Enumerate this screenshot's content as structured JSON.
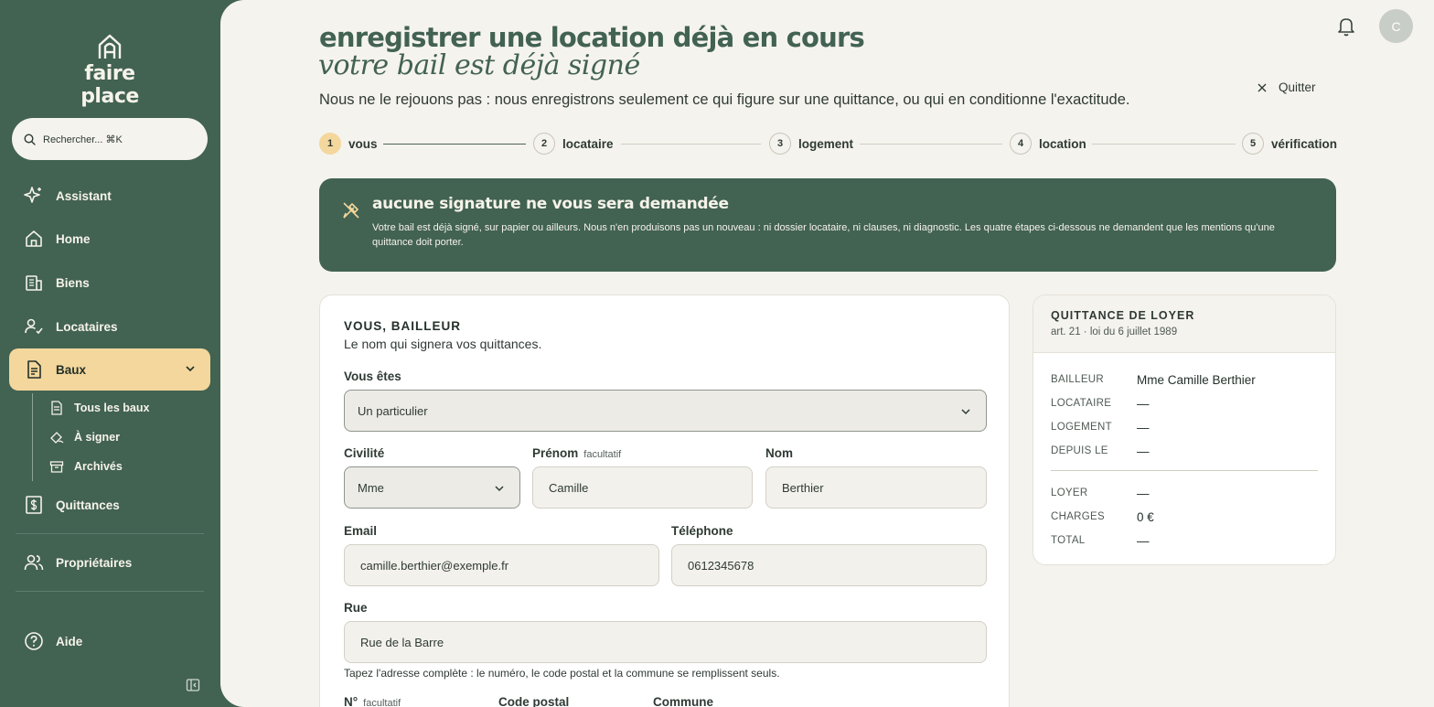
{
  "sidebar": {
    "brand": "faire place",
    "search_placeholder": "Rechercher... ⌘K",
    "items": [
      {
        "label": "Assistant",
        "icon": "sparkle-icon"
      },
      {
        "label": "Home",
        "icon": "home-icon"
      },
      {
        "label": "Biens",
        "icon": "building-icon"
      },
      {
        "label": "Locataires",
        "icon": "user-check-icon"
      },
      {
        "label": "Baux",
        "icon": "document-icon",
        "active": true
      },
      {
        "label": "Quittances",
        "icon": "receipt-icon"
      },
      {
        "label": "Propriétaires",
        "icon": "users-icon"
      },
      {
        "label": "Aide",
        "icon": "help-circle-icon"
      }
    ],
    "subitems": [
      {
        "label": "Tous les baux",
        "icon": "file-icon"
      },
      {
        "label": "À signer",
        "icon": "signature-icon"
      },
      {
        "label": "Archivés",
        "icon": "archive-icon"
      }
    ]
  },
  "header": {
    "avatar_initial": "C",
    "title": "enregistrer une location déjà en cours",
    "subtitle": "votre bail est déjà signé",
    "lead": "Nous ne le rejouons pas : nous enregistrons seulement ce qui figure sur une quittance, ou qui en conditionne l'exactitude.",
    "quit_label": "Quitter"
  },
  "steps": [
    {
      "num": "1",
      "label": "vous",
      "current": true
    },
    {
      "num": "2",
      "label": "locataire"
    },
    {
      "num": "3",
      "label": "logement"
    },
    {
      "num": "4",
      "label": "location"
    },
    {
      "num": "5",
      "label": "vérification"
    }
  ],
  "banner": {
    "title": "aucune signature ne vous sera demandée",
    "text": "Votre bail est déjà signé, sur papier ou ailleurs. Nous n'en produisons pas un nouveau : ni dossier locataire, ni clauses, ni diagnostic. Les quatre étapes ci-dessous ne demandent que les mentions qu'une quittance doit porter."
  },
  "form": {
    "section_title": "VOUS, BAILLEUR",
    "section_sub": "Le nom qui signera vos quittances.",
    "vous_etes": {
      "label": "Vous êtes",
      "value": "Un particulier"
    },
    "civilite": {
      "label": "Civilité",
      "value": "Mme"
    },
    "prenom": {
      "label": "Prénom",
      "optional": "facultatif",
      "value": "Camille"
    },
    "nom": {
      "label": "Nom",
      "value": "Berthier"
    },
    "email": {
      "label": "Email",
      "value": "camille.berthier@exemple.fr"
    },
    "telephone": {
      "label": "Téléphone",
      "value": "0612345678"
    },
    "rue": {
      "label": "Rue",
      "value": "Rue de la Barre"
    },
    "rue_hint": "Tapez l'adresse complète : le numéro, le code postal et la commune se remplissent seuls.",
    "numero": {
      "label": "N°",
      "optional": "facultatif"
    },
    "code_postal": {
      "label": "Code postal"
    },
    "commune": {
      "label": "Commune"
    }
  },
  "receipt": {
    "title": "QUITTANCE DE LOYER",
    "subtitle": "art. 21 · loi du 6 juillet 1989",
    "rows": [
      {
        "key": "BAILLEUR",
        "value": "Mme Camille Berthier"
      },
      {
        "key": "LOCATAIRE",
        "value": "—"
      },
      {
        "key": "LOGEMENT",
        "value": "—"
      },
      {
        "key": "DEPUIS LE",
        "value": "—"
      }
    ],
    "totals": [
      {
        "key": "LOYER",
        "value": "—"
      },
      {
        "key": "CHARGES",
        "value": "0 €"
      },
      {
        "key": "TOTAL",
        "value": "—"
      }
    ]
  },
  "colors": {
    "brand_green": "#426252",
    "accent_yellow": "#f3d79c",
    "background": "#f5f3ee"
  }
}
